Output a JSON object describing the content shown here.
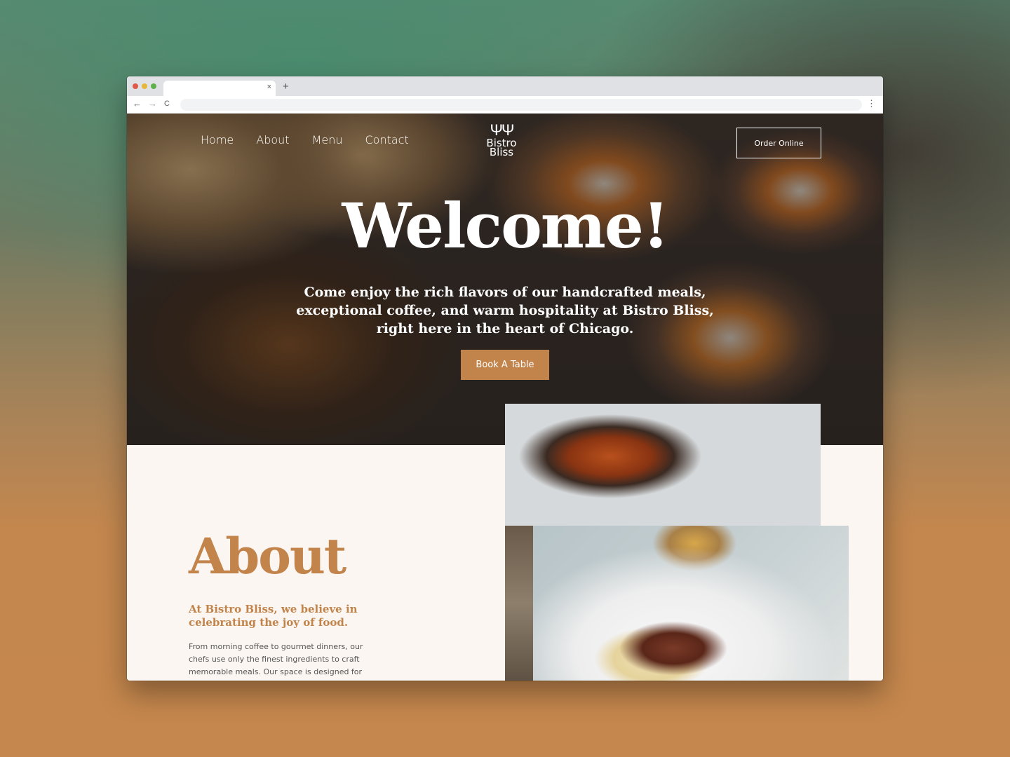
{
  "browser": {
    "dots": [
      "#e0594a",
      "#e5b73b",
      "#5db04a"
    ],
    "tab_close": "×",
    "new_tab": "+",
    "back": "←",
    "forward": "→",
    "reload": "C",
    "menu": "⋮"
  },
  "nav": {
    "items": [
      "Home",
      "About",
      "Menu",
      "Contact"
    ]
  },
  "logo": {
    "icon": "ΨΨ",
    "line1": "Bistro",
    "line2": "Bliss"
  },
  "order_button": "Order Online",
  "hero": {
    "title": "Welcome!",
    "subtitle": "Come enjoy the rich flavors of our handcrafted meals, exceptional coffee, and warm hospitality at Bistro Bliss, right here in the heart of Chicago.",
    "cta": "Book A Table"
  },
  "about": {
    "title": "About",
    "subtitle": "At Bistro Bliss, we believe in celebrating the joy of food.",
    "body": "From morning coffee to gourmet dinners, our chefs use only the finest ingredients to craft memorable meals. Our space is designed for"
  },
  "colors": {
    "accent": "#c3844b",
    "about_bg": "#fbf6f1"
  }
}
